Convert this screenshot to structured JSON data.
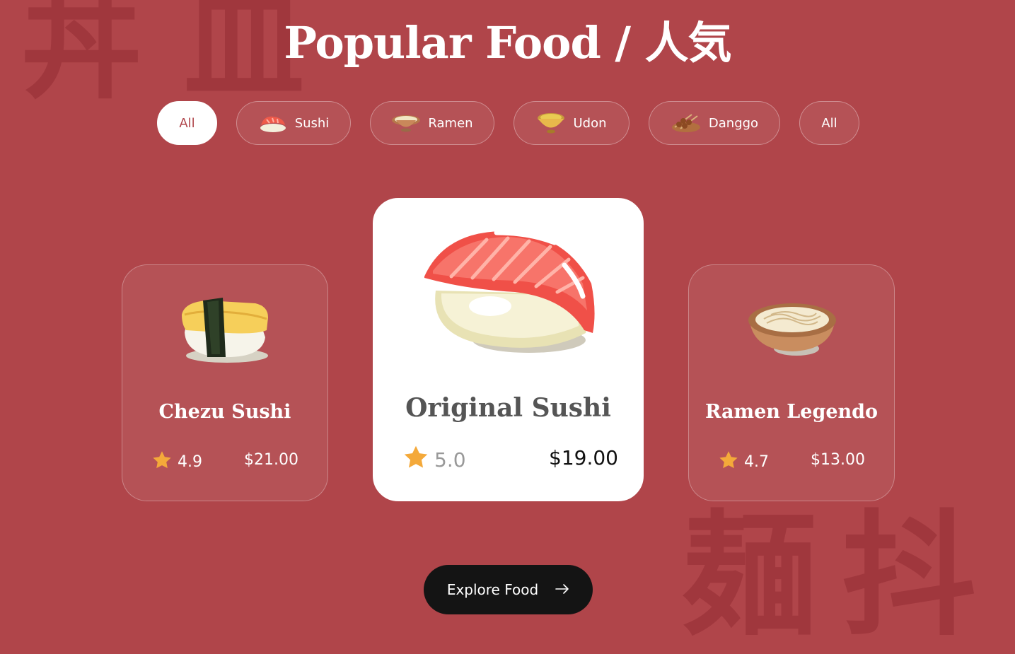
{
  "header": {
    "title": "Popular Food / 人気"
  },
  "filters": [
    {
      "label": "All",
      "icon": "none",
      "active": true
    },
    {
      "label": "Sushi",
      "icon": "sushi-icon"
    },
    {
      "label": "Ramen",
      "icon": "ramen-bowl-icon"
    },
    {
      "label": "Udon",
      "icon": "udon-bowl-icon"
    },
    {
      "label": "Danggo",
      "icon": "dango-skewer-icon"
    },
    {
      "label": "All",
      "icon": "none"
    }
  ],
  "cards": [
    {
      "name": "Chezu Sushi",
      "rating": "4.9",
      "price": "$21.00",
      "image": "tamago-sushi-icon"
    },
    {
      "name": "Original Sushi",
      "rating": "5.0",
      "price": "$19.00",
      "image": "salmon-sushi-icon"
    },
    {
      "name": "Ramen Legendo",
      "rating": "4.7",
      "price": "$13.00",
      "image": "ramen-bowl-icon"
    }
  ],
  "cta": {
    "label": "Explore Food",
    "icon": "arrow-right-icon"
  },
  "colors": {
    "background": "#b0454a",
    "star": "#f4a93a",
    "button": "#141414",
    "accent": "#b0454a"
  }
}
